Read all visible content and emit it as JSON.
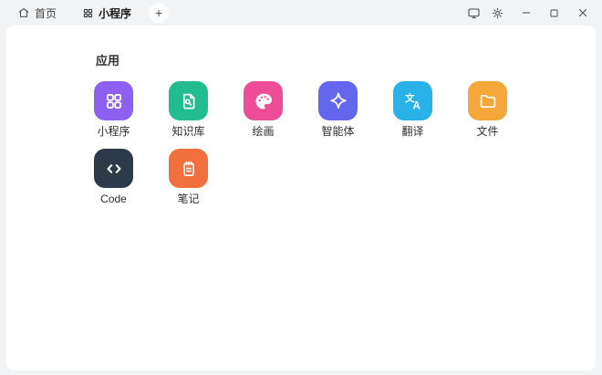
{
  "titlebar": {
    "tabs": [
      {
        "label": "首页",
        "icon": "home-icon",
        "active": false
      },
      {
        "label": "小程序",
        "icon": "grid-icon",
        "active": true
      }
    ],
    "new_tab_button": "+",
    "window_controls": [
      {
        "name": "display-icon"
      },
      {
        "name": "settings-icon"
      },
      {
        "name": "minimize-icon"
      },
      {
        "name": "maximize-icon"
      },
      {
        "name": "close-icon"
      }
    ]
  },
  "main": {
    "section_title": "应用",
    "apps": [
      {
        "label": "小程序",
        "icon": "mini-program-grid-icon",
        "color": "#8d60f0"
      },
      {
        "label": "知识库",
        "icon": "knowledge-doc-search-icon",
        "color": "#22bd8e"
      },
      {
        "label": "绘画",
        "icon": "paint-palette-icon",
        "color": "#ed4c97"
      },
      {
        "label": "智能体",
        "icon": "agent-sparkle-icon",
        "color": "#6367ee"
      },
      {
        "label": "翻译",
        "icon": "translate-icon",
        "color": "#29b2e8"
      },
      {
        "label": "文件",
        "icon": "folder-icon",
        "color": "#f5a73b"
      },
      {
        "label": "Code",
        "icon": "code-brackets-icon",
        "color": "#2d3a4a"
      },
      {
        "label": "笔记",
        "icon": "notepad-icon",
        "color": "#f2703e"
      }
    ]
  },
  "colors": {
    "page_bg": "#f2f3f5",
    "card_bg": "#ffffff",
    "control_icon": "#4a4a4a",
    "text_primary": "#333333"
  }
}
